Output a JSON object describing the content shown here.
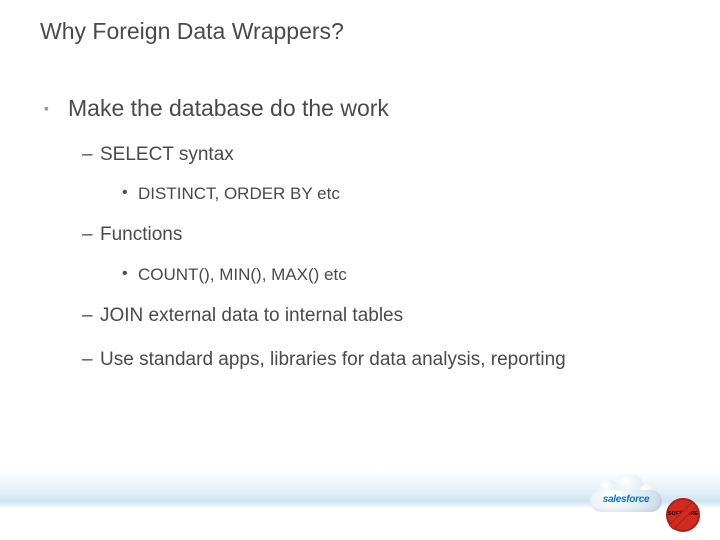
{
  "title": "Why Foreign Data Wrappers?",
  "bullets": {
    "l1_1": "Make the database do the work",
    "l2_1": "SELECT syntax",
    "l3_1": "DISTINCT, ORDER BY etc",
    "l2_2": "Functions",
    "l3_2": "COUNT(), MIN(), MAX() etc",
    "l2_3": "JOIN external data to internal tables",
    "l2_4": "Use standard apps, libraries for data analysis, reporting"
  },
  "logo": {
    "text": "salesforce",
    "badge": "SOFTWARE"
  }
}
